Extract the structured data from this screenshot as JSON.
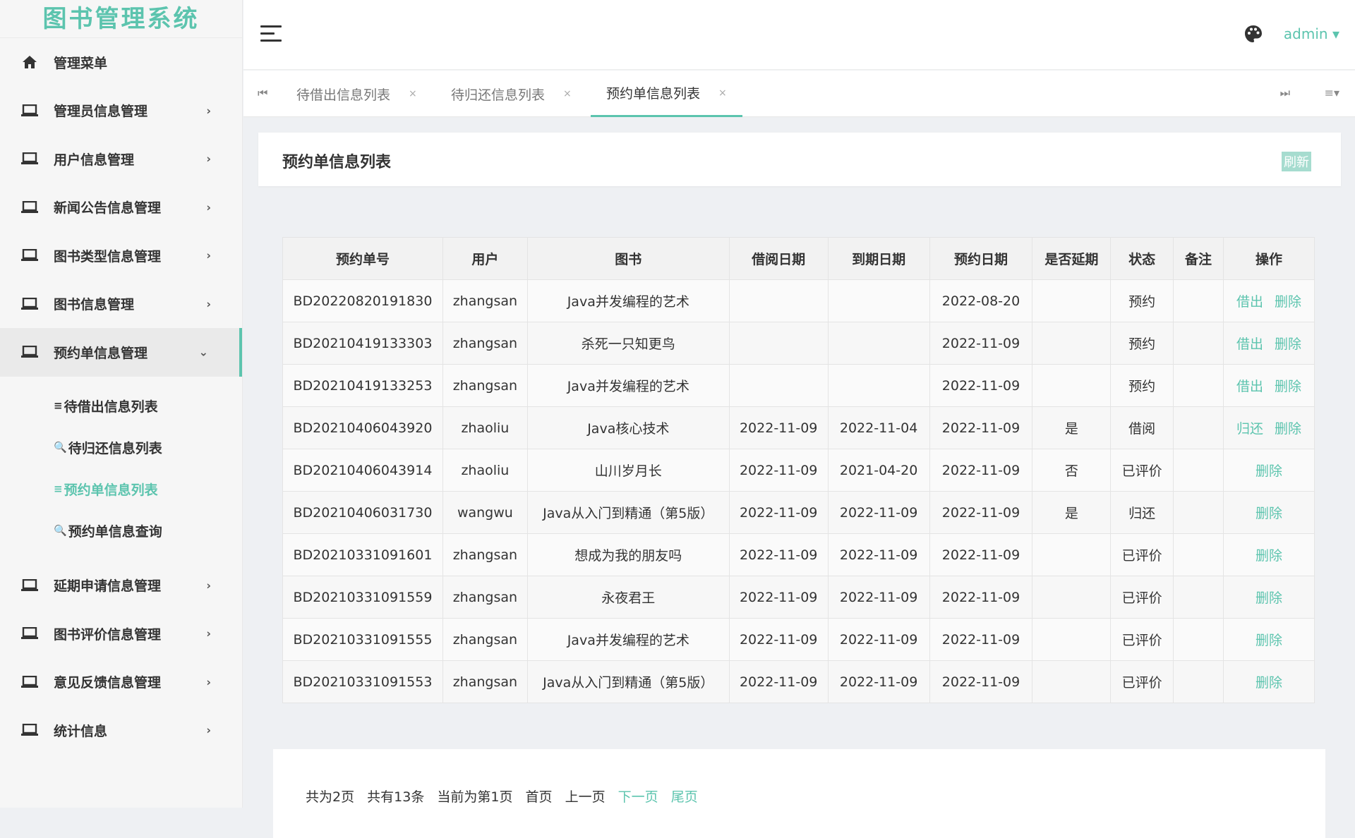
{
  "app_title": "图书管理系统",
  "header": {
    "user": "admin",
    "user_arrow": "▾"
  },
  "sidebar": {
    "items": [
      {
        "label": "管理菜单"
      },
      {
        "label": "管理员信息管理",
        "arrow": "›"
      },
      {
        "label": "用户信息管理",
        "arrow": "›"
      },
      {
        "label": "新闻公告信息管理",
        "arrow": "›"
      },
      {
        "label": "图书类型信息管理",
        "arrow": "›"
      },
      {
        "label": "图书信息管理",
        "arrow": "›"
      },
      {
        "label": "预约单信息管理",
        "arrow": "⌄"
      },
      {
        "label": "延期申请信息管理",
        "arrow": "›"
      },
      {
        "label": "图书评价信息管理",
        "arrow": "›"
      },
      {
        "label": "意见反馈信息管理",
        "arrow": "›"
      },
      {
        "label": "统计信息",
        "arrow": "›"
      }
    ],
    "subitems": [
      {
        "glyph": "≡",
        "label": "待借出信息列表"
      },
      {
        "glyph": "🔍",
        "label": "待归还信息列表"
      },
      {
        "glyph": "≡",
        "label": "预约单信息列表"
      },
      {
        "glyph": "🔍",
        "label": "预约单信息查询"
      }
    ]
  },
  "tabs": [
    {
      "label": "待借出信息列表",
      "close": "×"
    },
    {
      "label": "待归还信息列表",
      "close": "×"
    },
    {
      "label": "预约单信息列表",
      "close": "×"
    }
  ],
  "tab_nav": {
    "first": "⏮",
    "last": "⏭",
    "menu": "≡▾"
  },
  "page": {
    "title": "预约单信息列表",
    "refresh": "刷新"
  },
  "table": {
    "columns": [
      "预约单号",
      "用户",
      "图书",
      "借阅日期",
      "到期日期",
      "预约日期",
      "是否延期",
      "状态",
      "备注",
      "操作"
    ],
    "rows": [
      [
        "BD20220820191830",
        "zhangsan",
        "Java并发编程的艺术",
        "",
        "",
        "2022-08-20",
        "",
        "预约",
        "",
        "借出",
        "删除"
      ],
      [
        "BD20210419133303",
        "zhangsan",
        "杀死一只知更鸟",
        "",
        "",
        "2022-11-09",
        "",
        "预约",
        "",
        "借出",
        "删除"
      ],
      [
        "BD20210419133253",
        "zhangsan",
        "Java并发编程的艺术",
        "",
        "",
        "2022-11-09",
        "",
        "预约",
        "",
        "借出",
        "删除"
      ],
      [
        "BD20210406043920",
        "zhaoliu",
        "Java核心技术",
        "2022-11-09",
        "2022-11-04",
        "2022-11-09",
        "是",
        "借阅",
        "",
        "归还",
        "删除"
      ],
      [
        "BD20210406043914",
        "zhaoliu",
        "山川岁月长",
        "2022-11-09",
        "2021-04-20",
        "2022-11-09",
        "否",
        "已评价",
        "",
        "",
        "删除"
      ],
      [
        "BD20210406031730",
        "wangwu",
        "Java从入门到精通（第5版）",
        "2022-11-09",
        "2022-11-09",
        "2022-11-09",
        "是",
        "归还",
        "",
        "",
        "删除"
      ],
      [
        "BD20210331091601",
        "zhangsan",
        "想成为我的朋友吗",
        "2022-11-09",
        "2022-11-09",
        "2022-11-09",
        "",
        "已评价",
        "",
        "",
        "删除"
      ],
      [
        "BD20210331091559",
        "zhangsan",
        "永夜君王",
        "2022-11-09",
        "2022-11-09",
        "2022-11-09",
        "",
        "已评价",
        "",
        "",
        "删除"
      ],
      [
        "BD20210331091555",
        "zhangsan",
        "Java并发编程的艺术",
        "2022-11-09",
        "2022-11-09",
        "2022-11-09",
        "",
        "已评价",
        "",
        "",
        "删除"
      ],
      [
        "BD20210331091553",
        "zhangsan",
        "Java从入门到精通（第5版）",
        "2022-11-09",
        "2022-11-09",
        "2022-11-09",
        "",
        "已评价",
        "",
        "",
        "删除"
      ]
    ]
  },
  "pager": {
    "total_pages": "共为2页",
    "total_count": "共有13条",
    "current": "当前为第1页",
    "first": "首页",
    "prev": "上一页",
    "next": "下一页",
    "last": "尾页"
  },
  "colors": {
    "accent": "#5cc4ae",
    "sidebar_bg": "#f6f6f6",
    "content_bg": "#eef0f3"
  }
}
